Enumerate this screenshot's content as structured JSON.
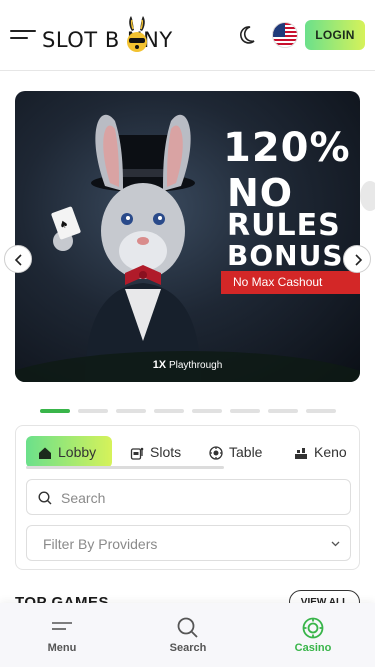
{
  "header": {
    "logo_text": "SLOT B  NNY",
    "login_label": "LOGIN"
  },
  "banner": {
    "promo_line1": "120%",
    "promo_line2": "NO",
    "promo_line3": "RULES",
    "promo_line4": "BONUS",
    "cashout_label": "No Max Cashout",
    "playthrough_multiplier": "1X",
    "playthrough_label": "Playthrough",
    "slide_count": 8,
    "active_slide": 1
  },
  "tabs": [
    {
      "label": "Lobby",
      "icon": "home-icon",
      "active": true
    },
    {
      "label": "Slots",
      "icon": "slot-machine-icon",
      "active": false
    },
    {
      "label": "Table",
      "icon": "poker-chip-icon",
      "active": false
    },
    {
      "label": "Keno",
      "icon": "keno-icon",
      "active": false
    }
  ],
  "search": {
    "placeholder": "Search"
  },
  "filter": {
    "label": "Filter By Providers"
  },
  "section": {
    "title": "TOP GAMES",
    "view_all_label": "VIEW ALL"
  },
  "bottom_nav": [
    {
      "label": "Menu",
      "icon": "menu-icon",
      "active": false
    },
    {
      "label": "Search",
      "icon": "search-icon",
      "active": false
    },
    {
      "label": "Casino",
      "icon": "casino-chip-icon",
      "active": true
    }
  ],
  "colors": {
    "accent_green": "#39b54a",
    "gradient_start": "#6be08b",
    "gradient_end": "#d6f25a",
    "cashout_red": "#d32727"
  }
}
